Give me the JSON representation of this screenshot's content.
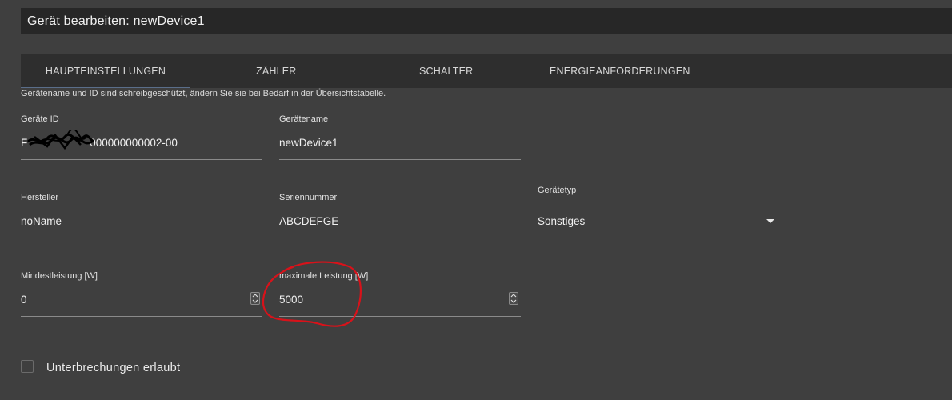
{
  "dialog": {
    "title": "Gerät bearbeiten: newDevice1"
  },
  "tabs": [
    {
      "label": "HAUPTEINSTELLUNGEN",
      "active": true
    },
    {
      "label": "ZÄHLER"
    },
    {
      "label": "SCHALTER"
    },
    {
      "label": "ENERGIEANFORDERUNGEN"
    }
  ],
  "hint": "Gerätename und ID sind schreibgeschützt, ändern Sie sie bei Bedarf in der Übersichtstabelle.",
  "fields": {
    "device_id": {
      "label": "Geräte ID",
      "value_prefix": "F",
      "value": "000000000002-00"
    },
    "device_name": {
      "label": "Gerätename",
      "value": "newDevice1"
    },
    "manufacturer": {
      "label": "Hersteller",
      "value": "noName"
    },
    "serial": {
      "label": "Seriennummer",
      "value": "ABCDEFGE"
    },
    "device_type": {
      "label": "Gerätetyp",
      "value": "Sonstiges"
    },
    "min_power": {
      "label": "Mindestleistung [W]",
      "value": "0"
    },
    "max_power": {
      "label": "maximale Leistung [W]",
      "value": "5000"
    }
  },
  "interruptions": {
    "label": "Unterbrechungen erlaubt",
    "checked": false
  },
  "colors": {
    "background": "#3f3f3f",
    "titlebar": "#272727",
    "tabbar": "#2e2e2e",
    "annotation": "#d8121a"
  }
}
